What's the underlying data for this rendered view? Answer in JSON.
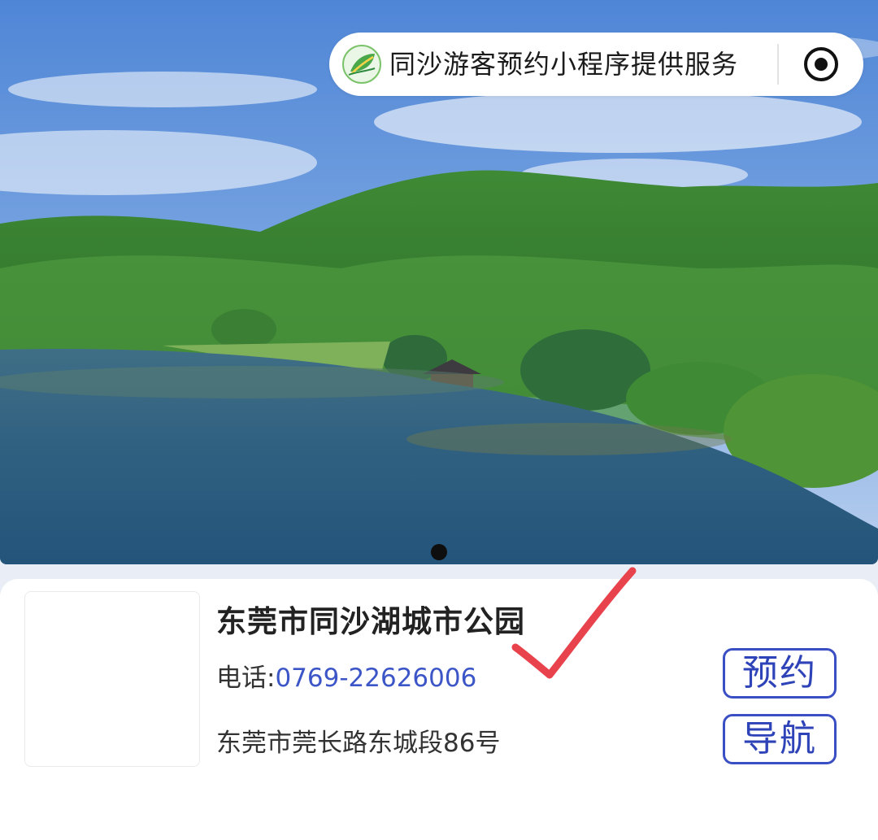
{
  "capsule": {
    "title": "同沙游客预约小程序提供服务",
    "logo_icon": "leaf-logo-icon",
    "record_icon": "record-icon"
  },
  "banner": {
    "slide_count": 1,
    "active_slide": 1
  },
  "park": {
    "name": "东莞市同沙湖城市公园",
    "phone_label": "电话:",
    "phone_number": "0769-22626006",
    "address": "东莞市莞长路东城段86号",
    "book_label": "预约",
    "navigate_label": "导航"
  },
  "colors": {
    "accent": "#3b4fc4",
    "check_mark": "#e8434d",
    "link": "#3d56c7"
  }
}
